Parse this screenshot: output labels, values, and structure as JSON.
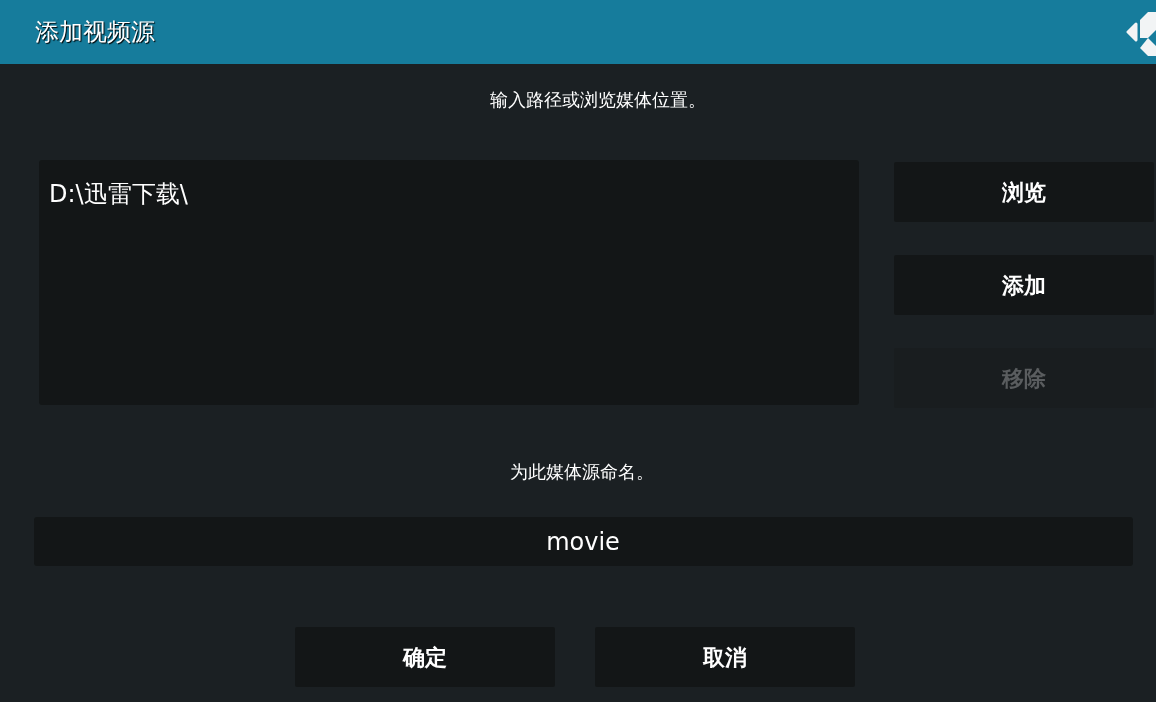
{
  "window": {
    "title": "添加视频源"
  },
  "path_prompt": "输入路径或浏览媒体位置。",
  "paths": [
    "D:\\迅雷下载\\"
  ],
  "side_buttons": [
    {
      "label": "浏览",
      "disabled": false
    },
    {
      "label": "添加",
      "disabled": false
    },
    {
      "label": "移除",
      "disabled": true
    }
  ],
  "name_prompt": "为此媒体源命名。",
  "name_field": {
    "value": "movie"
  },
  "buttons": [
    {
      "label": "确定"
    },
    {
      "label": "取消"
    }
  ]
}
